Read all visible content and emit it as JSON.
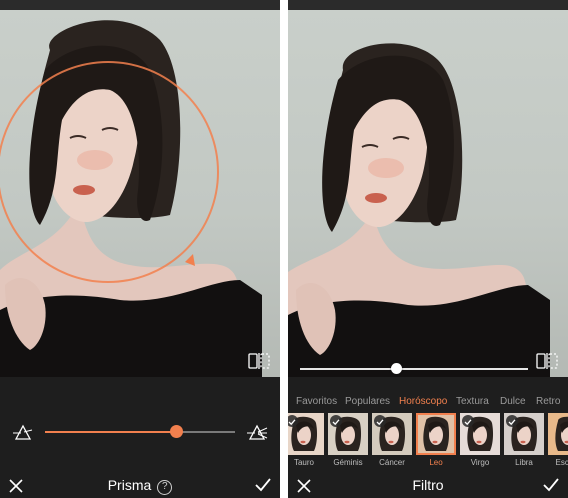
{
  "left": {
    "tool_title": "Prisma",
    "help_glyph": "?",
    "slider_value": 0.69,
    "accent_color": "#f2804e",
    "icons": [
      "prism-low-icon",
      "prism-high-icon",
      "compare-icon",
      "close-icon",
      "check-icon",
      "help-icon"
    ]
  },
  "right": {
    "title": "Filtro",
    "strength_value": 0.42,
    "tabs": [
      {
        "label": "Favoritos",
        "active": false
      },
      {
        "label": "Populares",
        "active": false
      },
      {
        "label": "Horóscopo",
        "active": true
      },
      {
        "label": "Textura",
        "active": false
      },
      {
        "label": "Dulce",
        "active": false
      },
      {
        "label": "Retro",
        "active": false
      }
    ],
    "filters": [
      {
        "label": "Tauro",
        "selected": false
      },
      {
        "label": "Géminis",
        "selected": false
      },
      {
        "label": "Cáncer",
        "selected": false
      },
      {
        "label": "Leo",
        "selected": true
      },
      {
        "label": "Virgo",
        "selected": false
      },
      {
        "label": "Libra",
        "selected": false
      },
      {
        "label": "Escorp",
        "selected": false
      }
    ]
  }
}
